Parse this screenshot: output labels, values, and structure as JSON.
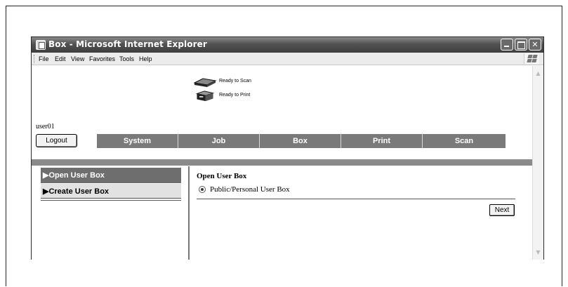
{
  "window": {
    "title": "Box - Microsoft Internet Explorer",
    "controls": [
      "minimize",
      "maximize",
      "close"
    ]
  },
  "menubar": {
    "items": [
      "File",
      "Edit",
      "View",
      "Favorites",
      "Tools",
      "Help"
    ]
  },
  "status": {
    "scanner": "Ready to Scan",
    "printer": "Ready to Print"
  },
  "user": {
    "name": "user01",
    "logout_label": "Logout"
  },
  "nav": {
    "tabs": [
      "System",
      "Job",
      "Box",
      "Print",
      "Scan"
    ]
  },
  "sidebar": {
    "items": [
      {
        "label": "▶Open User Box",
        "active": true
      },
      {
        "label": "▶Create User Box",
        "active": false
      }
    ]
  },
  "main": {
    "title": "Open User Box",
    "option_label": "Public/Personal User Box",
    "option_selected": true,
    "next_label": "Next"
  },
  "colors": {
    "titlebar": "#525252",
    "nav_bg": "#7a7a7a",
    "divider": "#8a8a8a",
    "active_item": "#6e6e6e"
  },
  "icons": {
    "scanner": "scanner-icon",
    "printer": "printer-icon",
    "app": "ie-page-icon",
    "logo": "windows-logo-icon"
  }
}
